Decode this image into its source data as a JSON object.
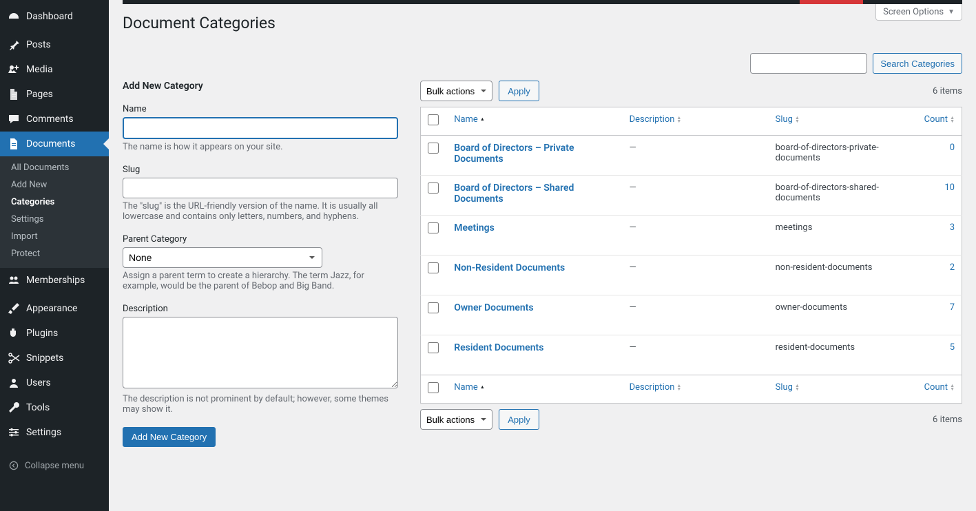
{
  "header": {
    "title": "Document Categories",
    "screen_options": "Screen Options"
  },
  "sidebar": {
    "items": [
      {
        "label": "Dashboard",
        "icon": "dashboard"
      },
      {
        "label": "Posts",
        "icon": "pin"
      },
      {
        "label": "Media",
        "icon": "media"
      },
      {
        "label": "Pages",
        "icon": "page"
      },
      {
        "label": "Comments",
        "icon": "comment"
      },
      {
        "label": "Documents",
        "icon": "document",
        "active": true
      },
      {
        "label": "Memberships",
        "icon": "groups"
      },
      {
        "label": "Appearance",
        "icon": "brush"
      },
      {
        "label": "Plugins",
        "icon": "plugin"
      },
      {
        "label": "Snippets",
        "icon": "scissors"
      },
      {
        "label": "Users",
        "icon": "user"
      },
      {
        "label": "Tools",
        "icon": "wrench"
      },
      {
        "label": "Settings",
        "icon": "settings"
      }
    ],
    "submenu": [
      {
        "label": "All Documents"
      },
      {
        "label": "Add New"
      },
      {
        "label": "Categories",
        "current": true
      },
      {
        "label": "Settings"
      },
      {
        "label": "Import"
      },
      {
        "label": "Protect"
      }
    ],
    "collapse": "Collapse menu"
  },
  "search": {
    "button": "Search Categories"
  },
  "form": {
    "heading": "Add New Category",
    "name_label": "Name",
    "name_desc": "The name is how it appears on your site.",
    "slug_label": "Slug",
    "slug_desc": "The \"slug\" is the URL-friendly version of the name. It is usually all lowercase and contains only letters, numbers, and hyphens.",
    "parent_label": "Parent Category",
    "parent_value": "None",
    "parent_desc": "Assign a parent term to create a hierarchy. The term Jazz, for example, would be the parent of Bebop and Big Band.",
    "desc_label": "Description",
    "desc_desc": "The description is not prominent by default; however, some themes may show it.",
    "submit": "Add New Category"
  },
  "table": {
    "bulk_label": "Bulk actions",
    "apply": "Apply",
    "item_count": "6 items",
    "columns": {
      "name": "Name",
      "description": "Description",
      "slug": "Slug",
      "count": "Count"
    },
    "rows": [
      {
        "name": "Board of Directors – Private Documents",
        "description": "—",
        "slug": "board-of-directors-private-documents",
        "count": "0"
      },
      {
        "name": "Board of Directors – Shared Documents",
        "description": "—",
        "slug": "board-of-directors-shared-documents",
        "count": "10"
      },
      {
        "name": "Meetings",
        "description": "—",
        "slug": "meetings",
        "count": "3"
      },
      {
        "name": "Non-Resident Documents",
        "description": "—",
        "slug": "non-resident-documents",
        "count": "2"
      },
      {
        "name": "Owner Documents",
        "description": "—",
        "slug": "owner-documents",
        "count": "7"
      },
      {
        "name": "Resident Documents",
        "description": "—",
        "slug": "resident-documents",
        "count": "5"
      }
    ]
  }
}
